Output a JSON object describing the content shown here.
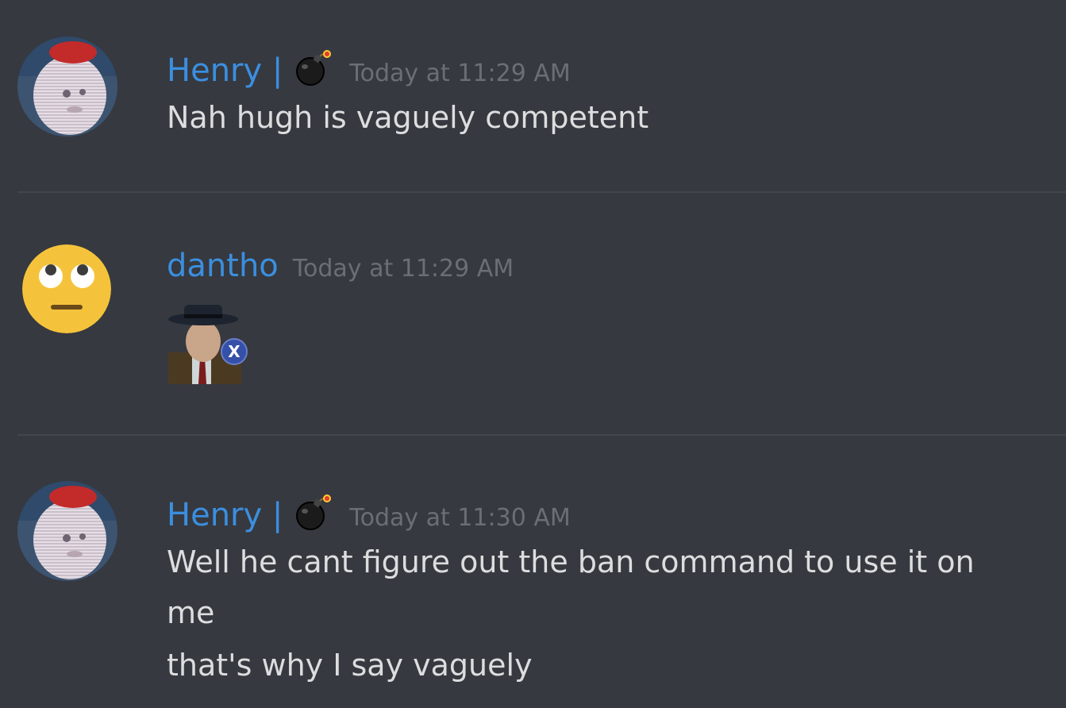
{
  "messages": [
    {
      "username": "Henry |",
      "badge_icon": "bomb-icon",
      "timestamp": "Today at 11:29 AM",
      "lines": [
        "Nah hugh is vaguely competent"
      ]
    },
    {
      "username": "dantho",
      "avatar_icon": "eye-roll-emoji-icon",
      "timestamp": "Today at 11:29 AM",
      "sticker_icon": "detective-sticker-icon",
      "sticker_badge": "X"
    },
    {
      "username": "Henry |",
      "badge_icon": "bomb-icon",
      "timestamp": "Today at 11:30 AM",
      "lines": [
        "Well he cant figure out the ban command to use it on",
        "me",
        "that's why I say vaguely"
      ]
    }
  ],
  "colors": {
    "background": "#36393f",
    "username": "#3b8fdf",
    "timestamp": "#6a6e75",
    "text": "#dcddde",
    "divider": "#42454a"
  }
}
